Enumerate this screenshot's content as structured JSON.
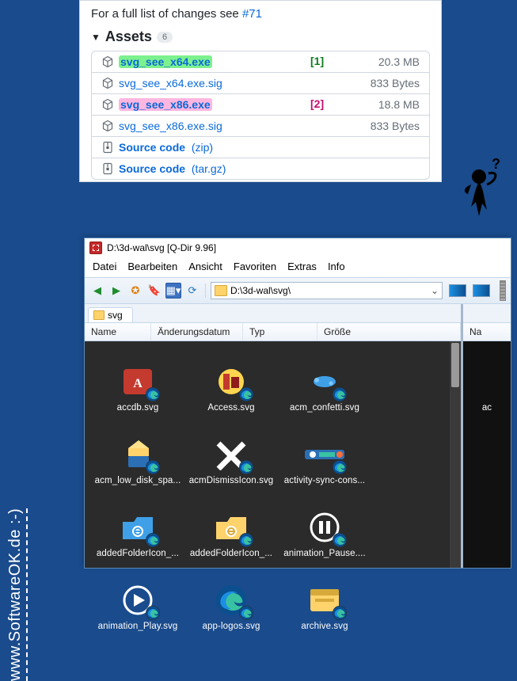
{
  "watermark": "www.SoftwareOK.de :-)",
  "github": {
    "intro_prefix": "For a full list of changes see ",
    "intro_link": "#71",
    "assets_label": "Assets",
    "assets_count": "6",
    "badge1": "[1]",
    "badge2": "[2]",
    "rows": [
      {
        "name": "svg_see_x64.exe",
        "size": "20.3 MB",
        "hl": "green",
        "bold": true,
        "icon": "cube"
      },
      {
        "name": "svg_see_x64.exe.sig",
        "size": "833 Bytes",
        "icon": "cube"
      },
      {
        "name": "svg_see_x86.exe",
        "size": "18.8 MB",
        "hl": "pink",
        "bold": true,
        "icon": "cube"
      },
      {
        "name": "svg_see_x86.exe.sig",
        "size": "833 Bytes",
        "icon": "cube"
      },
      {
        "name": "Source code",
        "suffix": "(zip)",
        "icon": "zip"
      },
      {
        "name": "Source code",
        "suffix": "(tar.gz)",
        "icon": "zip"
      }
    ]
  },
  "qdir": {
    "title": "D:\\3d-wal\\svg  [Q-Dir 9.96]",
    "menu": [
      "Datei",
      "Bearbeiten",
      "Ansicht",
      "Favoriten",
      "Extras",
      "Info"
    ],
    "address_value": "D:\\3d-wal\\svg\\",
    "tab_left": "svg",
    "cols_left": {
      "name": "Name",
      "date": "Änderungsdatum",
      "typ": "Typ",
      "size": "Größe"
    },
    "cols_right": {
      "name": "Na"
    },
    "files_left": [
      "accdb.svg",
      "Access.svg",
      "acm_confetti.svg",
      "acm_low_disk_spa...",
      "acmDismissIcon.svg",
      "activity-sync-cons...",
      "addedFolderIcon_...",
      "addedFolderIcon_...",
      "animation_Pause....",
      "animation_Play.svg",
      "app-logos.svg",
      "archive.svg"
    ],
    "files_right": [
      "ac"
    ]
  }
}
